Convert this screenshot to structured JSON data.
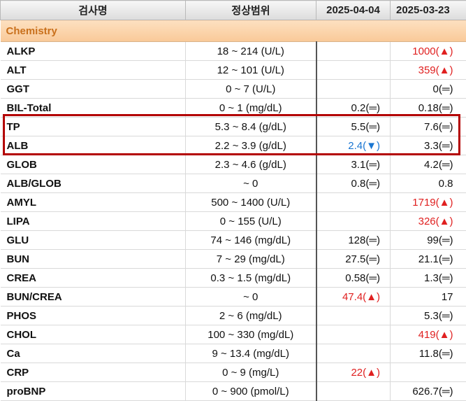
{
  "table": {
    "headers": [
      "검사명",
      "정상범위",
      "2025-04-04",
      "2025-03-23"
    ],
    "category": "Chemistry",
    "rows": [
      {
        "name": "ALKP",
        "range": "18 ~ 214 (U/L)",
        "v1": "",
        "v2": "1000(▲)"
      },
      {
        "name": "ALT",
        "range": "12 ~ 101 (U/L)",
        "v1": "",
        "v2": "359(▲)"
      },
      {
        "name": "GGT",
        "range": "0 ~ 7 (U/L)",
        "v1": "",
        "v2": "0(═)"
      },
      {
        "name": "BIL-Total",
        "range": "0 ~ 1 (mg/dL)",
        "v1": "0.2(═)",
        "v2": "0.18(═)"
      },
      {
        "name": "TP",
        "range": "5.3 ~ 8.4 (g/dL)",
        "v1": "5.5(═)",
        "v2": "7.6(═)"
      },
      {
        "name": "ALB",
        "range": "2.2 ~ 3.9 (g/dL)",
        "v1": "2.4(▼)",
        "v2": "3.3(═)"
      },
      {
        "name": "GLOB",
        "range": "2.3 ~ 4.6 (g/dL)",
        "v1": "3.1(═)",
        "v2": "4.2(═)"
      },
      {
        "name": "ALB/GLOB",
        "range": "~ 0",
        "v1": "0.8(═)",
        "v2": "0.8"
      },
      {
        "name": "AMYL",
        "range": "500 ~ 1400 (U/L)",
        "v1": "",
        "v2": "1719(▲)"
      },
      {
        "name": "LIPA",
        "range": "0 ~ 155 (U/L)",
        "v1": "",
        "v2": "326(▲)"
      },
      {
        "name": "GLU",
        "range": "74 ~ 146 (mg/dL)",
        "v1": "128(═)",
        "v2": "99(═)"
      },
      {
        "name": "BUN",
        "range": "7 ~ 29 (mg/dL)",
        "v1": "27.5(═)",
        "v2": "21.1(═)"
      },
      {
        "name": "CREA",
        "range": "0.3 ~ 1.5 (mg/dL)",
        "v1": "0.58(═)",
        "v2": "1.3(═)"
      },
      {
        "name": "BUN/CREA",
        "range": "~ 0",
        "v1": "47.4(▲)",
        "v2": "17"
      },
      {
        "name": "PHOS",
        "range": "2 ~ 6 (mg/dL)",
        "v1": "",
        "v2": "5.3(═)"
      },
      {
        "name": "CHOL",
        "range": "100 ~ 330 (mg/dL)",
        "v1": "",
        "v2": "419(▲)"
      },
      {
        "name": "Ca",
        "range": "9 ~ 13.4 (mg/dL)",
        "v1": "",
        "v2": "11.8(═)"
      },
      {
        "name": "CRP",
        "range": "0 ~ 9 (mg/L)",
        "v1": "22(▲)",
        "v2": ""
      },
      {
        "name": "proBNP",
        "range": "0 ~ 900 (pmol/L)",
        "v1": "",
        "v2": "626.7(═)"
      }
    ]
  },
  "colors": {
    "high": "#e02020",
    "low": "#1a76d2",
    "highlight_box": "#b30000",
    "category_text": "#c9701c"
  }
}
